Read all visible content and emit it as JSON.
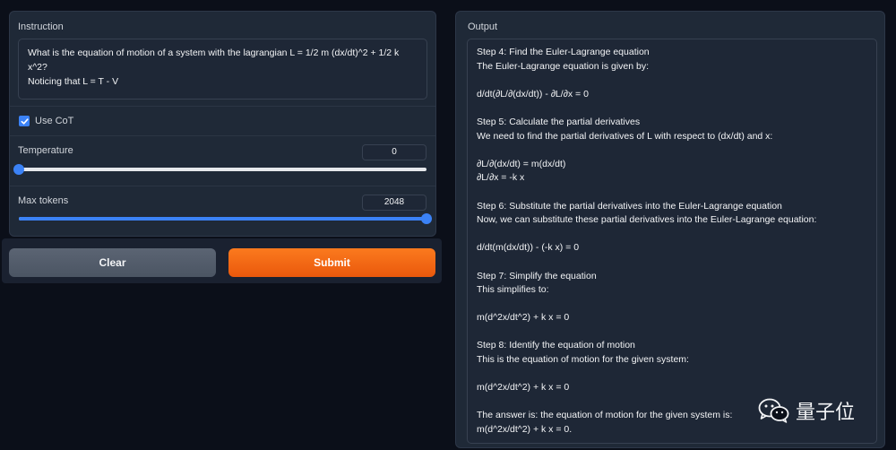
{
  "instruction": {
    "label": "Instruction",
    "text": "What is the equation of motion of a system with the lagrangian L = 1/2 m (dx/dt)^2 + 1/2 k x^2?\nNoticing that L = T - V"
  },
  "cot": {
    "label": "Use CoT",
    "checked": true
  },
  "temperature": {
    "label": "Temperature",
    "value": "0",
    "fraction": 0.0
  },
  "max_tokens": {
    "label": "Max tokens",
    "value": "2048",
    "fraction": 1.0
  },
  "buttons": {
    "clear": "Clear",
    "submit": "Submit"
  },
  "output": {
    "label": "Output",
    "text": "Step 4: Find the Euler-Lagrange equation\nThe Euler-Lagrange equation is given by:\n\nd/dt(∂L/∂(dx/dt)) - ∂L/∂x = 0\n\nStep 5: Calculate the partial derivatives\nWe need to find the partial derivatives of L with respect to (dx/dt) and x:\n\n∂L/∂(dx/dt) = m(dx/dt)\n∂L/∂x = -k x\n\nStep 6: Substitute the partial derivatives into the Euler-Lagrange equation\nNow, we can substitute these partial derivatives into the Euler-Lagrange equation:\n\nd/dt(m(dx/dt)) - (-k x) = 0\n\nStep 7: Simplify the equation\nThis simplifies to:\n\nm(d^2x/dt^2) + k x = 0\n\nStep 8: Identify the equation of motion\nThis is the equation of motion for the given system:\n\nm(d^2x/dt^2) + k x = 0\n\nThe answer is: the equation of motion for the given system is:\nm(d^2x/dt^2) + k x = 0."
  },
  "watermark": {
    "text": "量子位",
    "icon": "wechat-icon"
  },
  "colors": {
    "accent": "#3b82f6",
    "submit": "#f97316",
    "panel": "#1f2937",
    "background": "#0b0f19"
  }
}
